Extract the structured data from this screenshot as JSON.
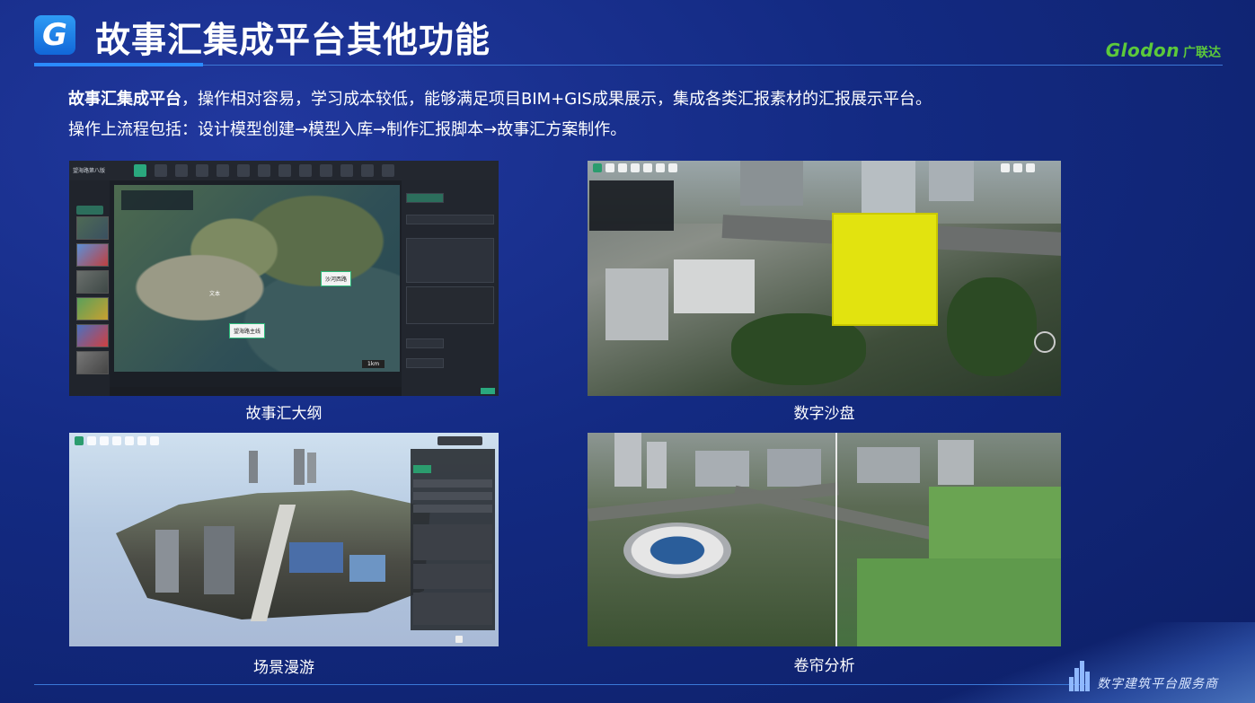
{
  "header": {
    "logo_letter": "G",
    "title": "故事汇集成平台其他功能",
    "brand_en": "Glodon",
    "brand_cn": "广联达"
  },
  "intro": {
    "line1_bold": "故事汇集成平台",
    "line1_rest": "，操作相对容易，学习成本较低，能够满足项目BIM+GIS成果展示，集成各类汇报素材的汇报展示平台。",
    "line2": "操作上流程包括：设计模型创建→模型入库→制作汇报脚本→故事汇方案制作。"
  },
  "panels": {
    "outline": {
      "caption": "故事汇大纲",
      "window_title": "望海路第八版",
      "map_label_1": "沙河西路",
      "map_label_2": "望海路主线",
      "map_text": "文本",
      "scale": "1km"
    },
    "sandtable": {
      "caption": "数字沙盘"
    },
    "roaming": {
      "caption": "场景漫游"
    },
    "split": {
      "caption": "卷帘分析"
    }
  },
  "footer": {
    "slogan": "数字建筑平台服务商"
  }
}
